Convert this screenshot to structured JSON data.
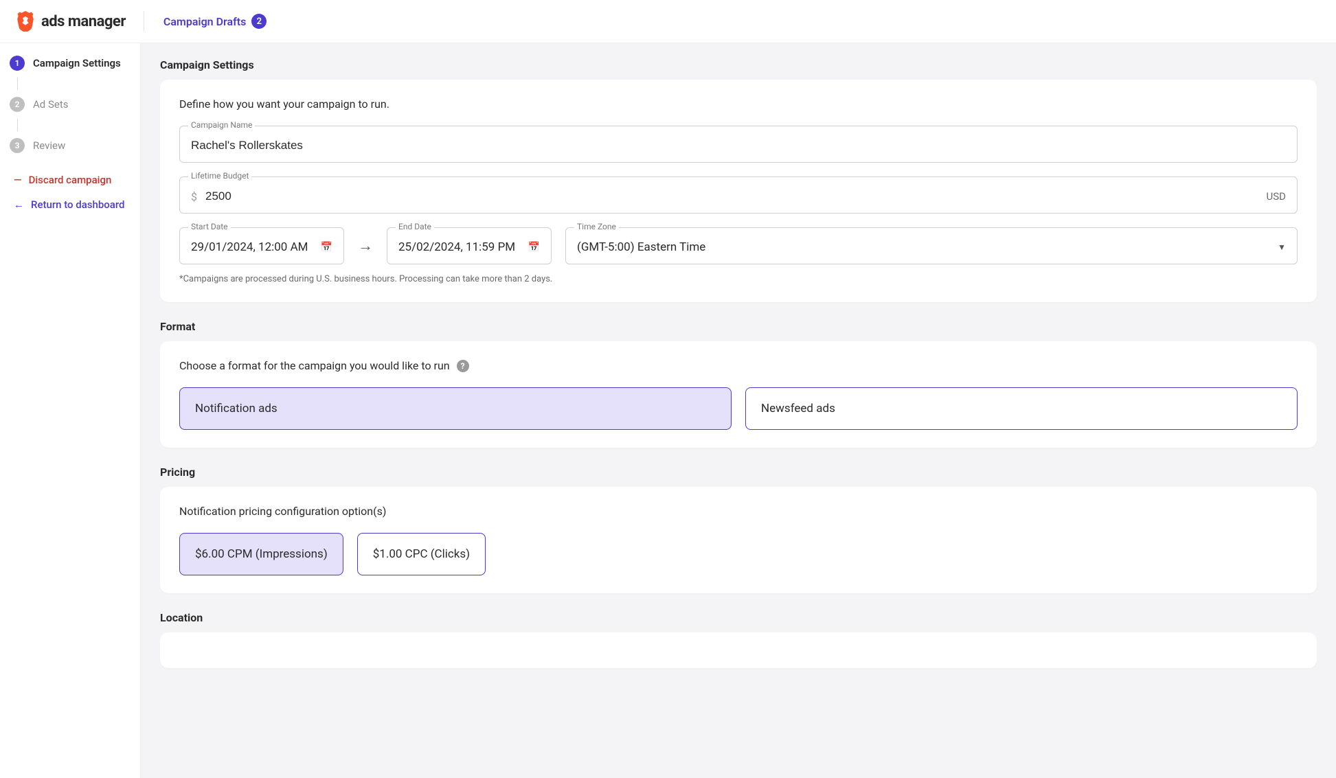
{
  "header": {
    "app_name": "ads manager",
    "drafts_label": "Campaign Drafts",
    "drafts_count": "2"
  },
  "sidebar": {
    "steps": [
      {
        "num": "1",
        "label": "Campaign Settings",
        "active": true
      },
      {
        "num": "2",
        "label": "Ad Sets",
        "active": false
      },
      {
        "num": "3",
        "label": "Review",
        "active": false
      }
    ],
    "discard_label": "Discard campaign",
    "return_label": "Return to dashboard"
  },
  "campaign_settings": {
    "section_title": "Campaign Settings",
    "desc": "Define how you want your campaign to run.",
    "name_legend": "Campaign Name",
    "name_value": "Rachel's Rollerskates",
    "budget_legend": "Lifetime Budget",
    "budget_prefix": "$",
    "budget_value": "2500",
    "budget_suffix": "USD",
    "start_legend": "Start Date",
    "start_value": "29/01/2024, 12:00 AM",
    "end_legend": "End Date",
    "end_value": "25/02/2024, 11:59 PM",
    "tz_legend": "Time Zone",
    "tz_value": "(GMT-5:00) Eastern Time",
    "footnote": "*Campaigns are processed during U.S. business hours. Processing can take more than 2 days."
  },
  "format": {
    "section_title": "Format",
    "desc": "Choose a format for the campaign you would like to run",
    "options": [
      {
        "label": "Notification ads",
        "selected": true
      },
      {
        "label": "Newsfeed ads",
        "selected": false
      }
    ]
  },
  "pricing": {
    "section_title": "Pricing",
    "desc": "Notification pricing configuration option(s)",
    "options": [
      {
        "label": "$6.00 CPM (Impressions)",
        "selected": true
      },
      {
        "label": "$1.00 CPC (Clicks)",
        "selected": false
      }
    ]
  },
  "location": {
    "section_title": "Location"
  }
}
